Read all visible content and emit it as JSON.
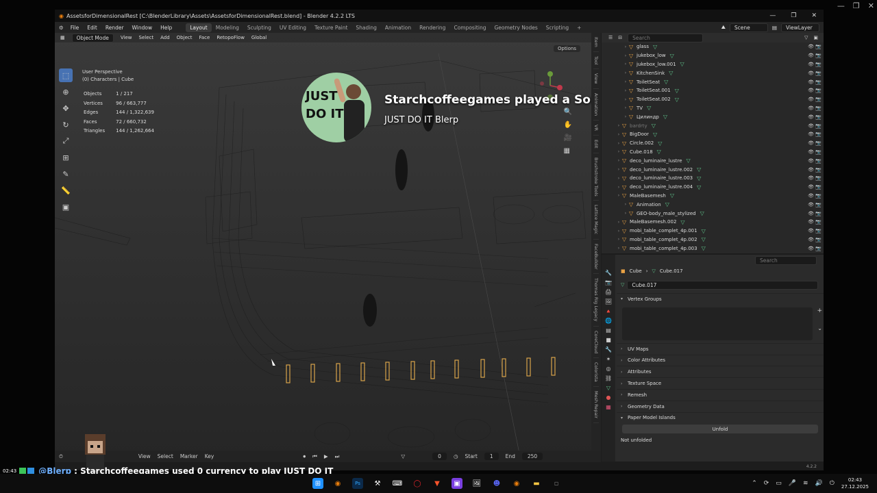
{
  "host": {
    "close": "✕",
    "restore": "❐",
    "minimize": "—"
  },
  "titlebar": {
    "title": "AssetsforDimensionalRest [C:\\BlenderLibrary\\Assets\\AssetsforDimensionalRest.blend] - Blender 4.2.2 LTS",
    "min": "—",
    "max": "❐",
    "close": "✕"
  },
  "menubar": {
    "menus": [
      "File",
      "Edit",
      "Render",
      "Window",
      "Help"
    ],
    "workspaces": [
      "Layout",
      "Modeling",
      "Sculpting",
      "UV Editing",
      "Texture Paint",
      "Shading",
      "Animation",
      "Rendering",
      "Compositing",
      "Geometry Nodes",
      "Scripting"
    ],
    "active_ws": "Layout",
    "scene": "Scene",
    "viewlayer": "ViewLayer"
  },
  "viewport": {
    "mode": "Object Mode",
    "view": "View",
    "select": "Select",
    "add": "Add",
    "object": "Object",
    "face": "Face",
    "retopo": "RetopoFlow",
    "orientation": "Global",
    "perspective": "User Perspective",
    "collection": "(0) Characters | Cube",
    "stats": [
      {
        "label": "Objects",
        "value": "1 / 217"
      },
      {
        "label": "Vertices",
        "value": "96 / 663,777"
      },
      {
        "label": "Edges",
        "value": "144 / 1,322,639"
      },
      {
        "label": "Faces",
        "value": "72 / 660,732"
      },
      {
        "label": "Triangles",
        "value": "144 / 1,262,664"
      }
    ],
    "options": "Options"
  },
  "ntabs": [
    "Item",
    "Tool",
    "View",
    "Animation",
    "VR",
    "Edit",
    "Brushstroke Tools",
    "Lattice Magic",
    "FaceBuilder",
    "Thomas Rig Legacy",
    "CoreCloud",
    "Colorista",
    "Mesh Repair"
  ],
  "timeline": {
    "view": "View",
    "select": "Select",
    "marker": "Marker",
    "key": "Key",
    "frame": "0",
    "start_label": "Start",
    "start": "1",
    "end_label": "End",
    "end": "250"
  },
  "outliner": {
    "search_placeholder": "Search",
    "rows": [
      {
        "name": "glass",
        "indent": 2,
        "dim": false
      },
      {
        "name": "jukebox_low",
        "indent": 2,
        "dim": false
      },
      {
        "name": "jukebox_low.001",
        "indent": 2,
        "dim": false
      },
      {
        "name": "KitchenSink",
        "indent": 2,
        "dim": false
      },
      {
        "name": "ToiletSeat",
        "indent": 2,
        "dim": false
      },
      {
        "name": "ToiletSeat.001",
        "indent": 2,
        "dim": false
      },
      {
        "name": "ToiletSeat.002",
        "indent": 2,
        "dim": false
      },
      {
        "name": "TV",
        "indent": 2,
        "dim": false
      },
      {
        "name": "Цилиндр",
        "indent": 2,
        "dim": false
      },
      {
        "name": "bardrty",
        "indent": 1,
        "dim": true
      },
      {
        "name": "BigDoor",
        "indent": 1,
        "dim": false
      },
      {
        "name": "Circle.002",
        "indent": 1,
        "dim": false
      },
      {
        "name": "Cube.018",
        "indent": 1,
        "dim": false
      },
      {
        "name": "deco_luminaire_lustre",
        "indent": 1,
        "dim": false
      },
      {
        "name": "deco_luminaire_lustre.002",
        "indent": 1,
        "dim": false
      },
      {
        "name": "deco_luminaire_lustre.003",
        "indent": 1,
        "dim": false
      },
      {
        "name": "deco_luminaire_lustre.004",
        "indent": 1,
        "dim": false
      },
      {
        "name": "MaleBasemesh",
        "indent": 1,
        "dim": false
      },
      {
        "name": "Animation",
        "indent": 2,
        "dim": false
      },
      {
        "name": "GEO-body_male_stylized",
        "indent": 2,
        "dim": false
      },
      {
        "name": "MaleBasemesh.002",
        "indent": 1,
        "dim": false
      },
      {
        "name": "mobi_table_complet_4p.001",
        "indent": 1,
        "dim": false
      },
      {
        "name": "mobi_table_complet_4p.002",
        "indent": 1,
        "dim": false
      },
      {
        "name": "mobi_table_complet_4p.003",
        "indent": 1,
        "dim": false
      }
    ]
  },
  "properties": {
    "search_placeholder": "Search",
    "breadcrumb_obj": "Cube",
    "breadcrumb_data": "Cube.017",
    "data_name": "Cube.017",
    "vertex_groups": "Vertex Groups",
    "sections": [
      "UV Maps",
      "Color Attributes",
      "Attributes",
      "Texture Space",
      "Remesh",
      "Geometry Data",
      "Paper Model Islands"
    ],
    "unfold": "Unfold",
    "not_unfolded": "Not unfolded",
    "version": "4.2.2"
  },
  "alert": {
    "avatar_text": "JUST\nDO IT!",
    "title": "Starchcoffeegames played a Sound!",
    "subtitle": "JUST DO IT Blerp"
  },
  "chat": {
    "time": "02:43",
    "user": "@Blerp",
    "message": ": Starchcoffeegames used 0 currency to play JUST DO IT"
  },
  "clock": {
    "time": "02:43",
    "date": "27.12.2025"
  },
  "colors": {
    "accent": "#4772b3",
    "object": "#e8a144",
    "mesh": "#5fc48b",
    "blender_bg": "#303030"
  }
}
